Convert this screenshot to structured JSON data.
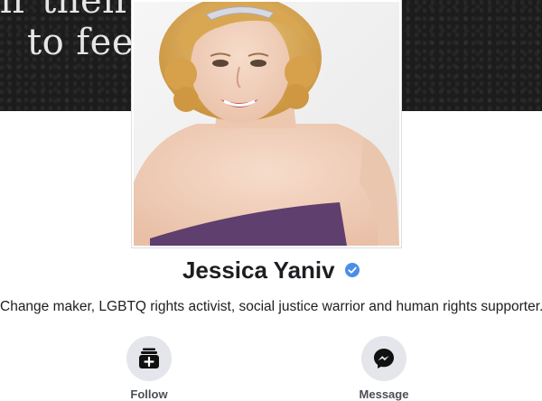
{
  "cover": {
    "line1": "ir their w                              worthy",
    "line2": "to feel                              nough."
  },
  "profile": {
    "name": "Jessica Yaniv",
    "bio": "Change maker, LGBTQ rights activist, social justice warrior and human rights supporter."
  },
  "actions": {
    "follow_label": "Follow",
    "message_label": "Message"
  },
  "icons": {
    "verified": "verified-badge-icon",
    "follow": "follow-icon",
    "message": "messenger-icon"
  },
  "colors": {
    "verified_blue": "#4a8ee9",
    "action_circle": "#e4e6eb",
    "text_dark": "#1c1e21"
  }
}
